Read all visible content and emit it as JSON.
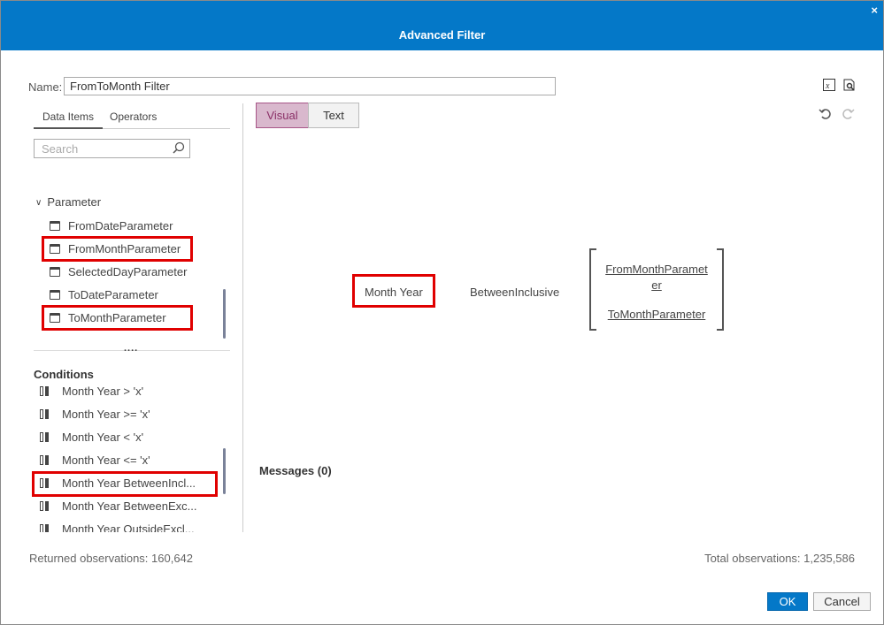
{
  "dialog": {
    "title": "Advanced Filter",
    "close_label": "×"
  },
  "name": {
    "label": "Name:",
    "value": "FromToMonth Filter"
  },
  "left_tabs": [
    "Data Items",
    "Operators"
  ],
  "search": {
    "placeholder": "Search"
  },
  "parameter": {
    "group_label": "Parameter",
    "items": [
      "FromDateParameter",
      "FromMonthParameter",
      "SelectedDayParameter",
      "ToDateParameter",
      "ToMonthParameter"
    ],
    "more": "...."
  },
  "conditions": {
    "title": "Conditions",
    "items": [
      "Month Year > 'x'",
      "Month Year >= 'x'",
      "Month Year < 'x'",
      "Month Year <= 'x'",
      "Month Year BetweenIncl...",
      "Month Year BetweenExc...",
      "Month Year OutsideExcl..."
    ]
  },
  "mode_toggle": {
    "visual": "Visual",
    "text": "Text",
    "selected": "Visual"
  },
  "expression": {
    "left": "Month Year",
    "operator": "BetweenInclusive",
    "from_line1": "FromMonthParamet",
    "from_line2": "er",
    "to": "ToMonthParameter"
  },
  "messages": "Messages (0)",
  "returned": "Returned observations:  160,642",
  "total": "Total observations:  1,235,586",
  "buttons": {
    "ok": "OK",
    "cancel": "Cancel"
  },
  "colors": {
    "title_bar": "#0478c8",
    "highlight": "#e00000",
    "visual_selected": "#d9b8cd"
  }
}
